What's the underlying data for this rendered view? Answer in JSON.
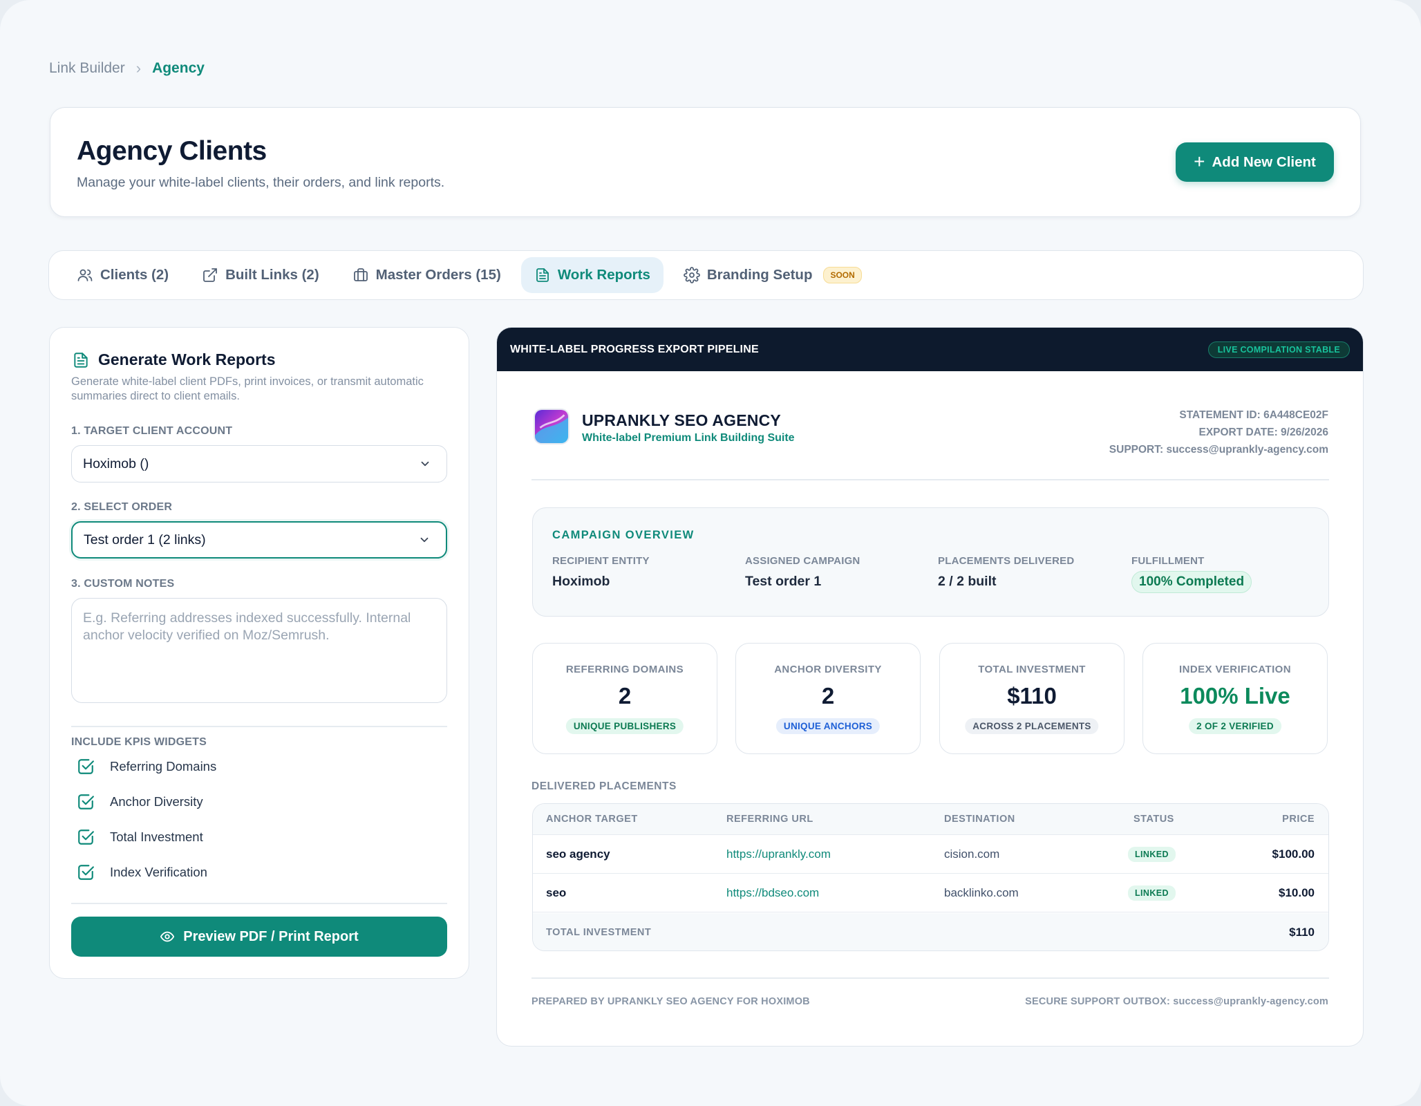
{
  "breadcrumb": {
    "parent": "Link Builder",
    "separator": "›",
    "current": "Agency"
  },
  "header": {
    "title": "Agency Clients",
    "subtitle": "Manage your white-label clients, their orders, and link reports.",
    "add_button": "Add New Client",
    "add_icon": "+"
  },
  "tabs": [
    {
      "label": "Clients (2)",
      "icon": "users-icon"
    },
    {
      "label": "Built Links (2)",
      "icon": "external-link-icon"
    },
    {
      "label": "Master Orders (15)",
      "icon": "briefcase-icon"
    },
    {
      "label": "Work Reports",
      "icon": "document-icon",
      "active": true
    },
    {
      "label": "Branding Setup",
      "icon": "gear-icon",
      "badge": "SOON"
    }
  ],
  "generator": {
    "title": "Generate Work Reports",
    "description": "Generate white-label client PDFs, print invoices, or transmit automatic summaries direct to client emails.",
    "client_label": "1. TARGET CLIENT ACCOUNT",
    "client_value": "Hoximob ()",
    "order_label": "2. SELECT ORDER",
    "order_value": "Test order 1 (2 links)",
    "notes_label": "3. CUSTOM NOTES",
    "notes_placeholder": "E.g. Referring addresses indexed successfully. Internal anchor velocity verified on Moz/Semrush.",
    "kpi_label": "INCLUDE KPIS WIDGETS",
    "kpi_options": [
      "Referring Domains",
      "Anchor Diversity",
      "Total Investment",
      "Index Verification"
    ],
    "preview_button": "Preview PDF / Print Report"
  },
  "report": {
    "bar_title": "WHITE-LABEL PROGRESS EXPORT PIPELINE",
    "live_badge": "LIVE COMPILATION STABLE",
    "agency_name": "UPRANKLY SEO AGENCY",
    "agency_tagline": "White-label Premium Link Building Suite",
    "statement_id": "STATEMENT ID: 6A448CE02F",
    "export_date": "EXPORT DATE: 9/26/2026",
    "support": "SUPPORT: success@uprankly-agency.com",
    "overview": {
      "title": "CAMPAIGN OVERVIEW",
      "recipient_label": "RECIPIENT ENTITY",
      "recipient_value": "Hoximob",
      "campaign_label": "ASSIGNED CAMPAIGN",
      "campaign_value": "Test order 1",
      "placements_label": "PLACEMENTS DELIVERED",
      "placements_value": "2 / 2 built",
      "fulfillment_label": "FULFILLMENT",
      "fulfillment_value": "100% Completed"
    },
    "kpis": [
      {
        "label": "REFERRING DOMAINS",
        "value": "2",
        "sub": "UNIQUE PUBLISHERS"
      },
      {
        "label": "ANCHOR DIVERSITY",
        "value": "2",
        "sub": "UNIQUE ANCHORS"
      },
      {
        "label": "TOTAL INVESTMENT",
        "value": "$110",
        "sub": "ACROSS 2 PLACEMENTS"
      },
      {
        "label": "INDEX VERIFICATION",
        "value": "100% Live",
        "sub": "2 OF 2 VERIFIED"
      }
    ],
    "placements_title": "DELIVERED PLACEMENTS",
    "table": {
      "headers": [
        "ANCHOR TARGET",
        "REFERRING URL",
        "DESTINATION",
        "STATUS",
        "PRICE"
      ],
      "rows": [
        {
          "anchor": "seo agency",
          "url": "https://uprankly.com",
          "destination": "cision.com",
          "status": "LINKED",
          "price": "$100.00"
        },
        {
          "anchor": "seo",
          "url": "https://bdseo.com",
          "destination": "backlinko.com",
          "status": "LINKED",
          "price": "$10.00"
        }
      ],
      "total_label": "TOTAL INVESTMENT",
      "total_value": "$110"
    },
    "footer_left": "PREPARED BY UPRANKLY SEO AGENCY FOR HOXIMOB",
    "footer_right": "SECURE SUPPORT OUTBOX: success@uprankly-agency.com"
  },
  "colors": {
    "accent": "#0f8a7a",
    "dark_bar": "#0d1a2d",
    "success": "#0c8a5c"
  }
}
